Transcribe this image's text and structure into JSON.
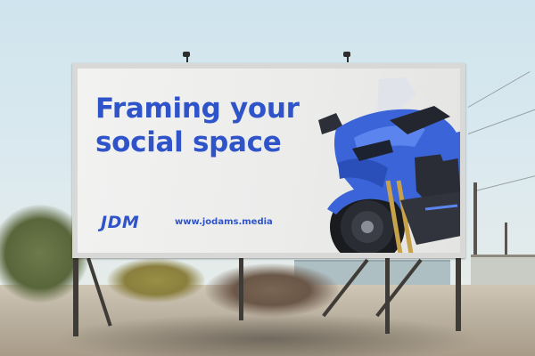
{
  "billboard": {
    "headline_line1": "Framing your",
    "headline_line2": "social space",
    "logo_text": "JDM",
    "website": "www.jodams.media",
    "brand_color": "#2f54c9"
  },
  "product_image": {
    "subject": "blue sport motorcycle",
    "color": "#3a64d8"
  }
}
